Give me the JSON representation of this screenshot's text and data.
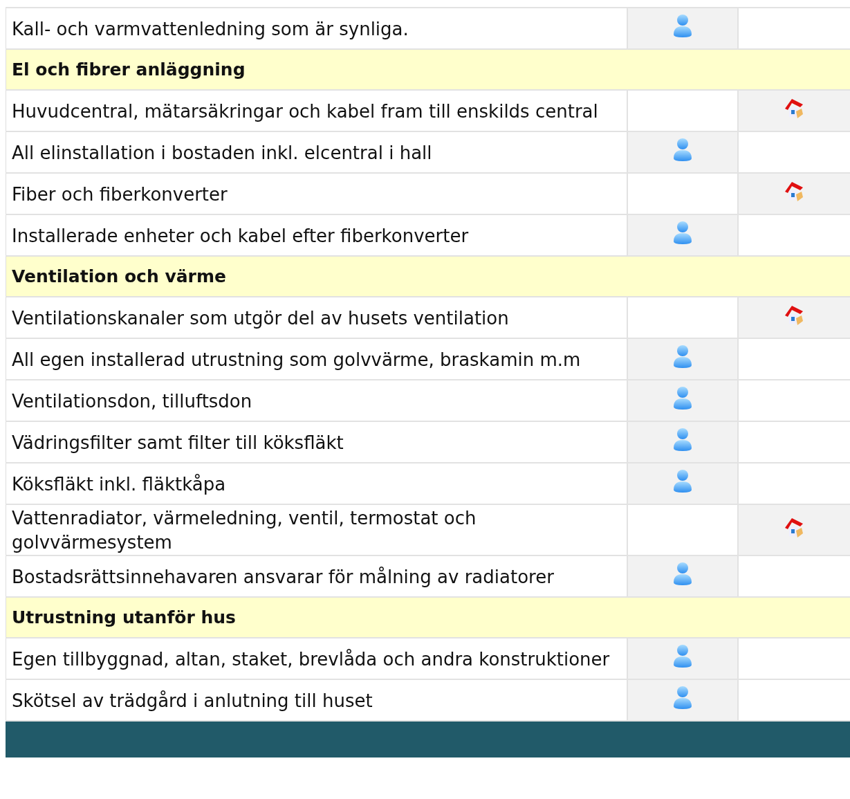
{
  "groups": [
    {
      "rows": [
        {
          "text": "Kall- och varmvattenledning som är synliga.",
          "member_responsible": true,
          "association_responsible": false
        }
      ]
    },
    {
      "title": "El och fibrer anläggning",
      "rows": [
        {
          "text": "Huvudcentral, mätarsäkringar och kabel fram till enskilds central",
          "member_responsible": false,
          "association_responsible": true
        },
        {
          "text": "All elinstallation i bostaden inkl. elcentral i hall",
          "member_responsible": true,
          "association_responsible": false
        },
        {
          "text": "Fiber och fiberkonverter",
          "member_responsible": false,
          "association_responsible": true
        },
        {
          "text": "Installerade enheter och kabel efter fiberkonverter",
          "member_responsible": true,
          "association_responsible": false
        }
      ]
    },
    {
      "title": "Ventilation och värme",
      "rows": [
        {
          "text": "Ventilationskanaler som utgör del av husets ventilation",
          "member_responsible": false,
          "association_responsible": true
        },
        {
          "text": "All egen installerad utrustning som golvvärme, braskamin m.m",
          "member_responsible": true,
          "association_responsible": false
        },
        {
          "text": "Ventilationsdon, tilluftsdon",
          "member_responsible": true,
          "association_responsible": false
        },
        {
          "text": "Vädringsfilter samt filter till köksfläkt",
          "member_responsible": true,
          "association_responsible": false
        },
        {
          "text": "Köksfläkt inkl. fläktkåpa",
          "member_responsible": true,
          "association_responsible": false
        },
        {
          "text": "Vattenradiator, värmeledning, ventil, termostat och golvvärmesystem",
          "member_responsible": false,
          "association_responsible": true
        },
        {
          "text": "Bostadsrättsinnehavaren ansvarar för målning av radiatorer",
          "member_responsible": true,
          "association_responsible": false
        }
      ]
    },
    {
      "title": "Utrustning utanför hus",
      "rows": [
        {
          "text": "Egen tillbyggnad, altan, staket, brevlåda och andra konstruktioner",
          "member_responsible": true,
          "association_responsible": false
        },
        {
          "text": "Skötsel av trädgård i anlutning till huset",
          "member_responsible": true,
          "association_responsible": false
        }
      ]
    }
  ]
}
